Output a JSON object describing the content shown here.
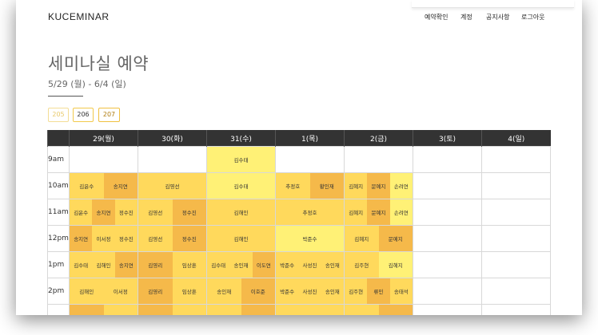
{
  "brand": "KUCEMINAR",
  "nav": [
    "예약확인",
    "계정",
    "공지사항",
    "로그아웃"
  ],
  "title": "세미나실 예약",
  "subtitle": "5/29 (월) - 6/4 (일)",
  "rooms": [
    {
      "label": "205",
      "state": "dim"
    },
    {
      "label": "206",
      "state": "normal"
    },
    {
      "label": "207",
      "state": "active"
    }
  ],
  "days": [
    "29(월)",
    "30(화)",
    "31(수)",
    "1(목)",
    "2(금)",
    "3(토)",
    "4(일)"
  ],
  "rows": [
    {
      "time": "9am",
      "cells": [
        [],
        [],
        [
          {
            "t": "김수태",
            "c": "c1"
          }
        ],
        [],
        [],
        [],
        []
      ]
    },
    {
      "time": "10am",
      "cells": [
        [
          {
            "t": "김윤수",
            "c": "c2"
          },
          {
            "t": "송지연",
            "c": "c3"
          }
        ],
        [
          {
            "t": "김영선",
            "c": "c2"
          }
        ],
        [
          {
            "t": "김수태",
            "c": "c1"
          }
        ],
        [
          {
            "t": "추정호",
            "c": "c2"
          },
          {
            "t": "황인재",
            "c": "c3"
          }
        ],
        [
          {
            "t": "김혜지",
            "c": "c2"
          },
          {
            "t": "문예지",
            "c": "c3"
          },
          {
            "t": "손려연",
            "c": "c1"
          }
        ],
        [],
        []
      ]
    },
    {
      "time": "11am",
      "cells": [
        [
          {
            "t": "김윤수",
            "c": "c2"
          },
          {
            "t": "송지연",
            "c": "c3"
          },
          {
            "t": "정수진",
            "c": "c2"
          }
        ],
        [
          {
            "t": "김영선",
            "c": "c2"
          },
          {
            "t": "정수진",
            "c": "c3"
          }
        ],
        [
          {
            "t": "김해인",
            "c": "c2"
          }
        ],
        [
          {
            "t": "추정호",
            "c": "c2"
          }
        ],
        [
          {
            "t": "김혜지",
            "c": "c2"
          },
          {
            "t": "문예지",
            "c": "c3"
          },
          {
            "t": "손려연",
            "c": "c1"
          }
        ],
        [],
        []
      ]
    },
    {
      "time": "12pm",
      "cells": [
        [
          {
            "t": "송지연",
            "c": "c3"
          },
          {
            "t": "이서정",
            "c": "c2"
          },
          {
            "t": "정수진",
            "c": "c2"
          }
        ],
        [
          {
            "t": "김영선",
            "c": "c2"
          },
          {
            "t": "정수진",
            "c": "c3"
          }
        ],
        [
          {
            "t": "김해인",
            "c": "c2"
          }
        ],
        [
          {
            "t": "박준수",
            "c": "c1"
          }
        ],
        [
          {
            "t": "김혜지",
            "c": "c2"
          },
          {
            "t": "문예지",
            "c": "c3"
          }
        ],
        [],
        []
      ]
    },
    {
      "time": "1pm",
      "cells": [
        [
          {
            "t": "김수태",
            "c": "c2"
          },
          {
            "t": "김해인",
            "c": "c2"
          },
          {
            "t": "송지연",
            "c": "c3"
          }
        ],
        [
          {
            "t": "김영리",
            "c": "c3"
          },
          {
            "t": "임상훈",
            "c": "c2"
          }
        ],
        [
          {
            "t": "김수태",
            "c": "c2"
          },
          {
            "t": "송인재",
            "c": "c2"
          },
          {
            "t": "이도연",
            "c": "c3"
          }
        ],
        [
          {
            "t": "박준수",
            "c": "c2"
          },
          {
            "t": "사성진",
            "c": "c2"
          },
          {
            "t": "송인재",
            "c": "c2"
          }
        ],
        [
          {
            "t": "김주현",
            "c": "c2"
          },
          {
            "t": "김혜지",
            "c": "c1"
          }
        ],
        [],
        []
      ]
    },
    {
      "time": "2pm",
      "cells": [
        [
          {
            "t": "김해인",
            "c": "c2"
          },
          {
            "t": "이서정",
            "c": "c2"
          }
        ],
        [
          {
            "t": "김영리",
            "c": "c3"
          },
          {
            "t": "임상훈",
            "c": "c2"
          }
        ],
        [
          {
            "t": "송인재",
            "c": "c2"
          },
          {
            "t": "이호준",
            "c": "c3"
          }
        ],
        [
          {
            "t": "박준수",
            "c": "c2"
          },
          {
            "t": "사성진",
            "c": "c2"
          },
          {
            "t": "송인재",
            "c": "c2"
          }
        ],
        [
          {
            "t": "김주현",
            "c": "c2"
          },
          {
            "t": "류민",
            "c": "c3"
          },
          {
            "t": "송태석",
            "c": "c2"
          }
        ],
        [],
        []
      ]
    },
    {
      "time": "",
      "cells": [
        [
          {
            "t": "",
            "c": "c3"
          },
          {
            "t": "",
            "c": "c2"
          }
        ],
        [
          {
            "t": "",
            "c": "c3"
          },
          {
            "t": "",
            "c": "c2"
          }
        ],
        [
          {
            "t": "",
            "c": "c2"
          },
          {
            "t": "",
            "c": "c3"
          }
        ],
        [
          {
            "t": "",
            "c": "c2"
          }
        ],
        [
          {
            "t": "",
            "c": "c2"
          },
          {
            "t": "",
            "c": "c3"
          }
        ],
        [],
        []
      ]
    }
  ]
}
